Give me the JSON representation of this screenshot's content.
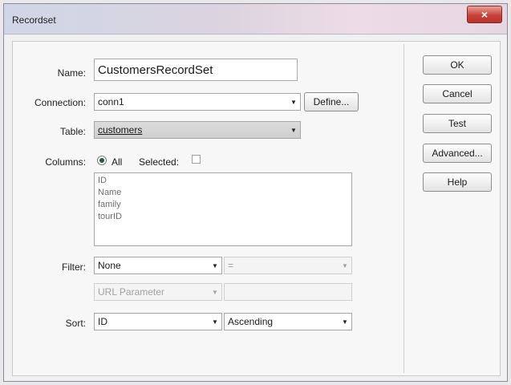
{
  "window": {
    "title": "Recordset",
    "close_glyph": "×"
  },
  "form": {
    "name_label": "Name:",
    "name_value": "CustomersRecordSet",
    "connection_label": "Connection:",
    "connection_value": "conn1",
    "define_button": "Define...",
    "table_label": "Table:",
    "table_value": "customers",
    "columns_label": "Columns:",
    "columns_all_label": "All",
    "columns_selected_label": "Selected:",
    "columns_mode": "All",
    "columns": [
      "ID",
      "Name",
      "family",
      "tourID"
    ],
    "filter_label": "Filter:",
    "filter_value": "None",
    "filter_operator": "=",
    "filter_source": "URL Parameter",
    "filter_param": "",
    "sort_label": "Sort:",
    "sort_column": "ID",
    "sort_order": "Ascending"
  },
  "buttons": {
    "ok": "OK",
    "cancel": "Cancel",
    "test": "Test",
    "advanced": "Advanced...",
    "help": "Help"
  },
  "icons": {
    "dropdown_arrow": "▼",
    "close": "close-icon"
  }
}
